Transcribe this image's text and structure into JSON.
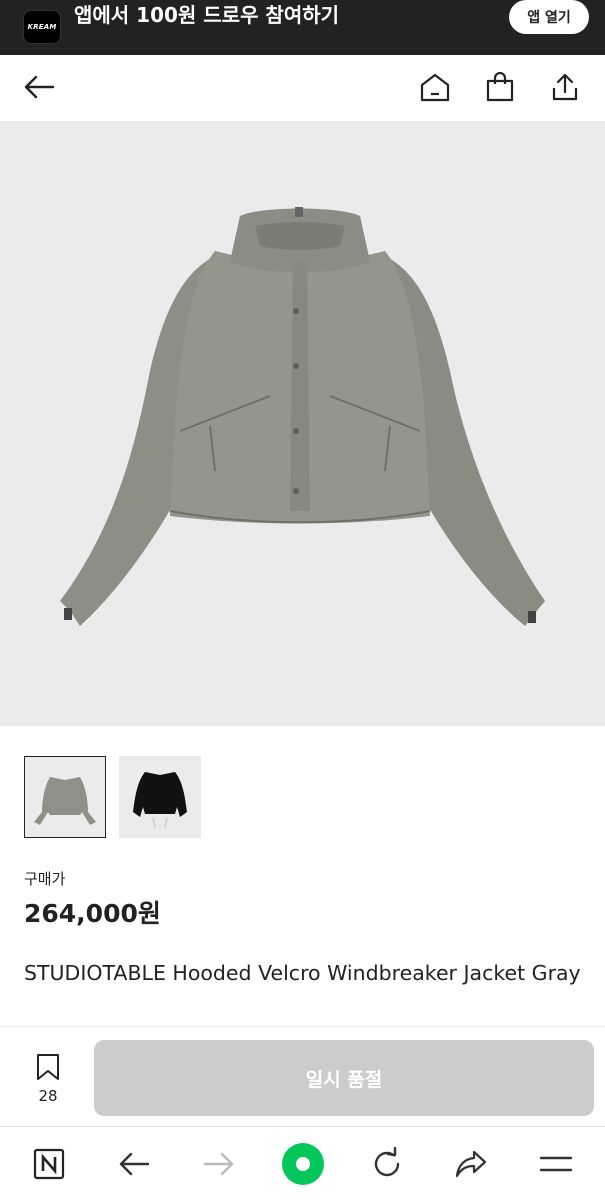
{
  "banner": {
    "logo_text": "KREAM",
    "promo_text": "앱에서 100원 드로우 참여하기",
    "open_app_label": "앱 열기"
  },
  "header": {
    "icons": [
      "back-arrow-icon",
      "home-icon",
      "shopping-bag-icon",
      "share-icon"
    ]
  },
  "product": {
    "image_alt": "gray jacket product photo",
    "thumbnails": [
      {
        "name": "gray-jacket-thumbnail",
        "selected": true
      },
      {
        "name": "black-jacket-thumbnail",
        "selected": false
      }
    ],
    "price_label": "구매가",
    "price": "264,000원",
    "title": "STUDIOTABLE Hooded Velcro Windbreaker Jacket Gray"
  },
  "action_bar": {
    "bookmark_count": "28",
    "soldout_label": "일시 품절"
  },
  "browser_nav": {
    "icons": [
      "naver-n-icon",
      "back-arrow-icon",
      "forward-arrow-icon",
      "green-dot-icon",
      "refresh-icon",
      "share-arrow-icon",
      "menu-icon"
    ]
  },
  "colors": {
    "banner_bg": "#222222",
    "soldout_bg": "#cccccc",
    "naver_green": "#03c75a"
  }
}
